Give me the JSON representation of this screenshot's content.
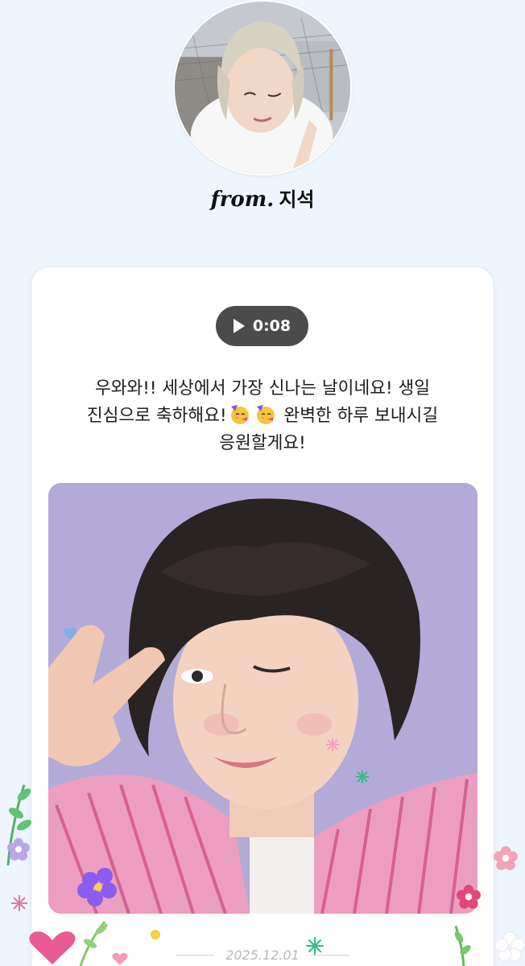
{
  "sender": {
    "from_label": "from.",
    "name": "지석"
  },
  "voice": {
    "duration": "0:08",
    "icon": "play-icon"
  },
  "message": {
    "line1": "우와와!! 세상에서 가장 신나는 날이네요! 생일",
    "line2_a": "진심으로 축하해요!",
    "line2_b": "완벽한 하루 보내시길",
    "line3": "응원할게요!",
    "emoji": "partying-face-icon"
  },
  "footer": {
    "date": "2025.12.01"
  },
  "colors": {
    "background": "#eef5fc",
    "card": "#ffffff",
    "play_button": "#4b4b4b",
    "date_text": "#b8b8b8"
  }
}
